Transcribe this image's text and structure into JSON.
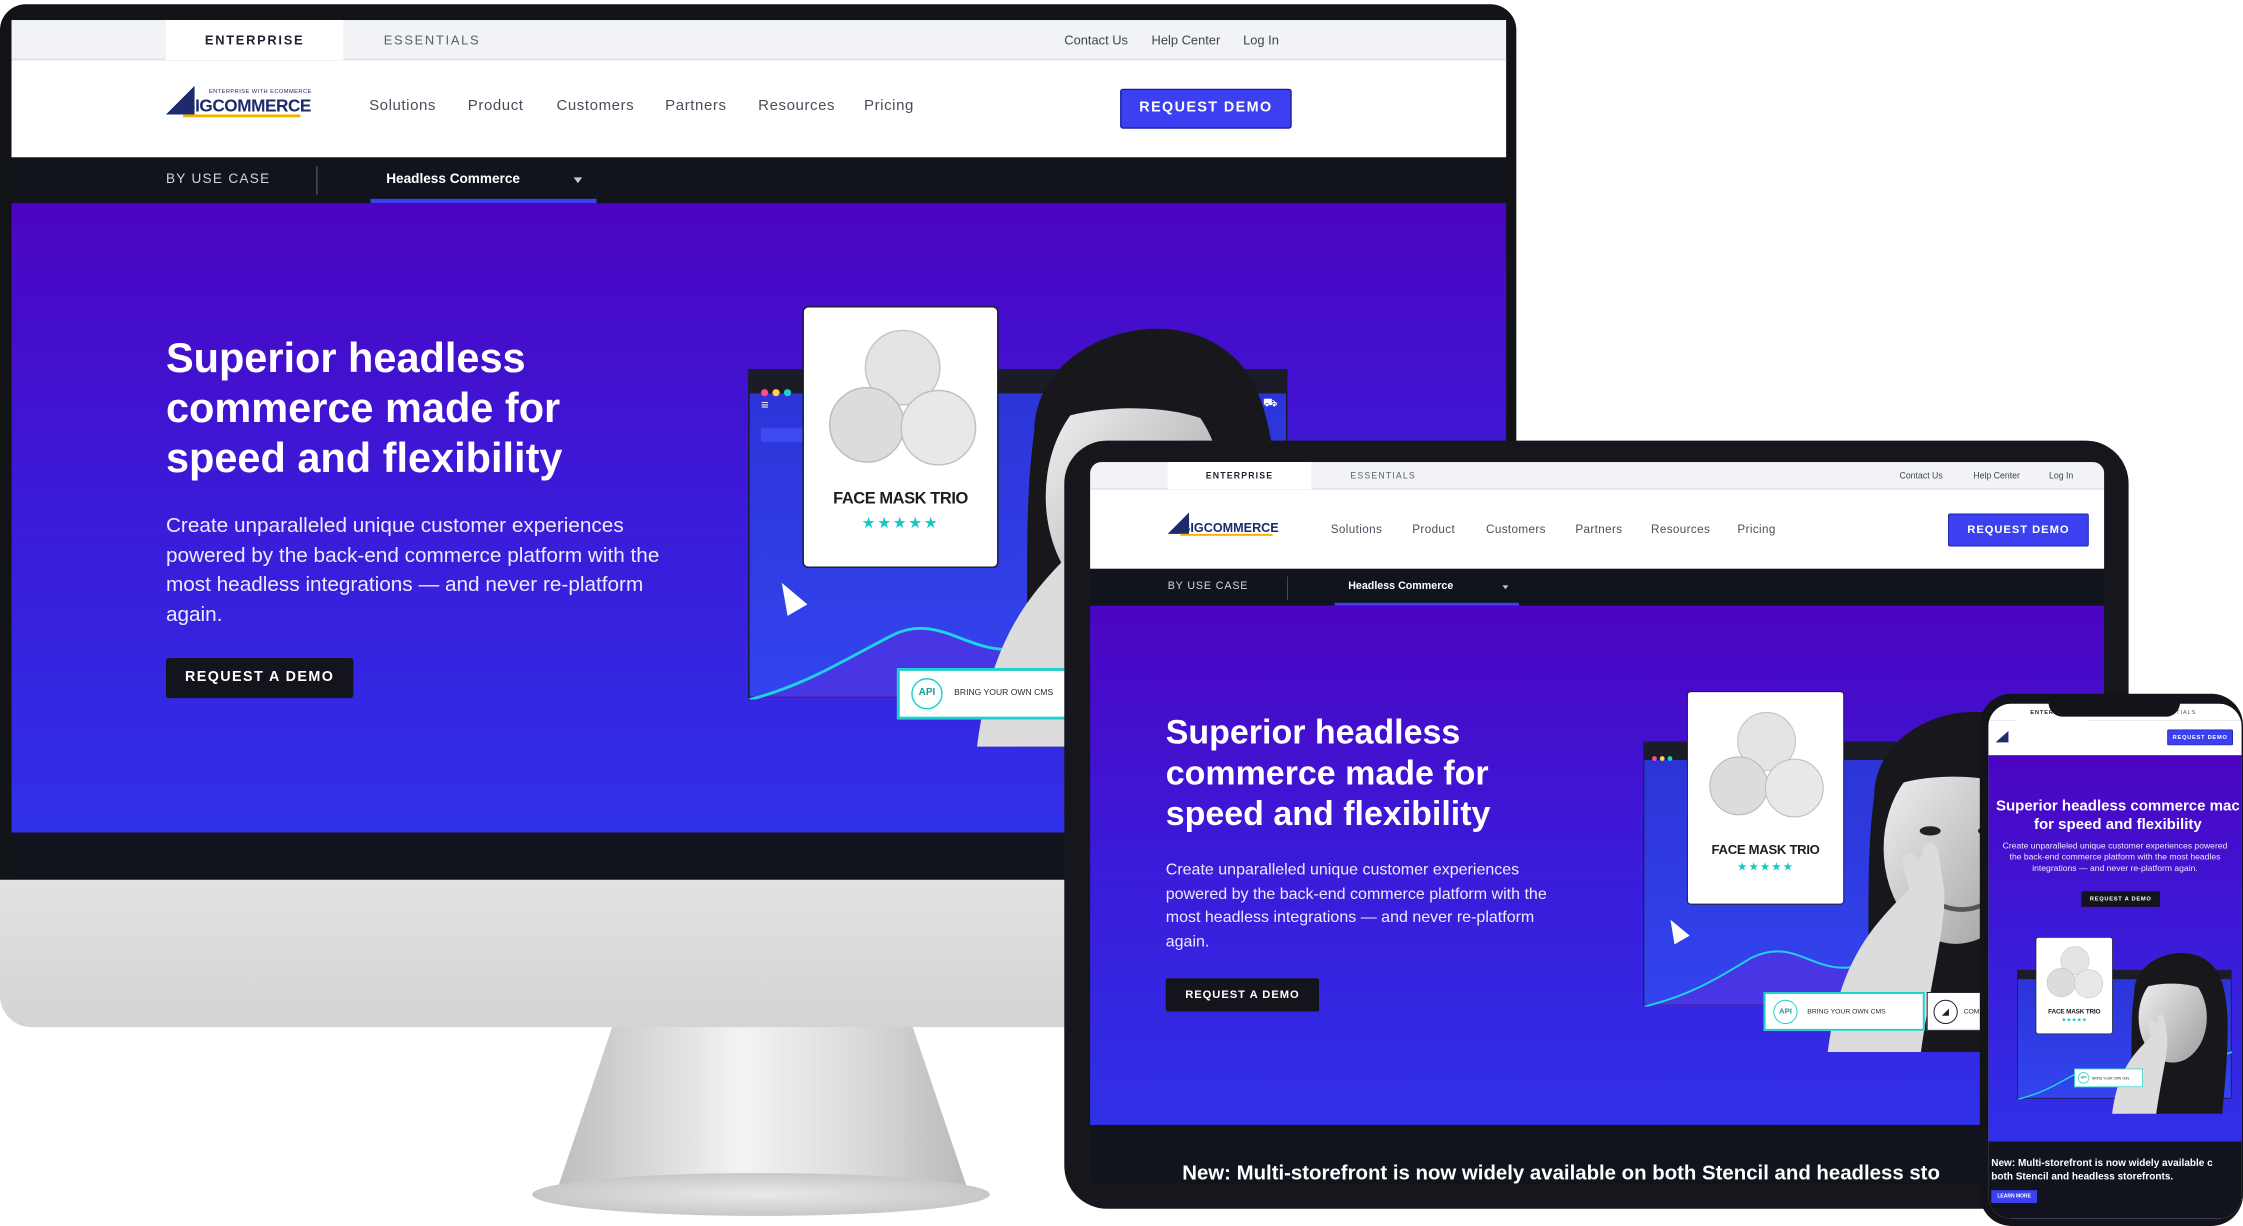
{
  "brand": {
    "logo_text": "BIGCOMMERCE",
    "logo_tagline": "ENTERPRISE WITH ECOMMERCE"
  },
  "topbar": {
    "tabs": [
      {
        "label": "ENTERPRISE",
        "active": true
      },
      {
        "label": "ESSENTIALS",
        "active": false
      }
    ],
    "links": {
      "contact": "Contact Us",
      "help": "Help Center",
      "login": "Log In"
    }
  },
  "nav": {
    "items": [
      "Solutions",
      "Product",
      "Customers",
      "Partners",
      "Resources",
      "Pricing"
    ],
    "cta": "REQUEST DEMO"
  },
  "subnav": {
    "by_use_case": "BY USE CASE",
    "selected": "Headless Commerce"
  },
  "hero": {
    "headline_lines": [
      "Superior headless",
      "commerce made for",
      "speed and flexibility"
    ],
    "mobile_headline_lines": [
      "Superior headless commerce mac",
      "for speed and flexibility"
    ],
    "body_lines": [
      "Create unparalleled unique customer experiences",
      "powered by the back-end commerce platform with the",
      "most headless integrations — and never re-platform",
      "again."
    ],
    "mobile_body_lines": [
      "Create unparalleled unique customer experiences powered",
      "the back-end commerce platform with the most headles",
      "integrations — and never re-platform again."
    ],
    "cta": "REQUEST A DEMO"
  },
  "product_card": {
    "name": "FACE MASK TRIO",
    "stars": "★★★★★"
  },
  "api_pill": {
    "badge": "API",
    "label": "BRING YOUR OWN CMS"
  },
  "api_pill_2": {
    "label": "COM"
  },
  "announcement": {
    "tablet": "New: Multi-storefront is now widely available on both Stencil and headless sto",
    "mobile_lines": [
      "New: Multi-storefront is now widely available c",
      "both Stencil and headless storefronts."
    ],
    "mobile_cta": "LEARN MORE"
  },
  "colors": {
    "accent": "#3c40f0",
    "hero_top": "#4c05c2",
    "hero_bottom": "#3030e8",
    "dark": "#12141d",
    "teal": "#1ed0cb"
  }
}
